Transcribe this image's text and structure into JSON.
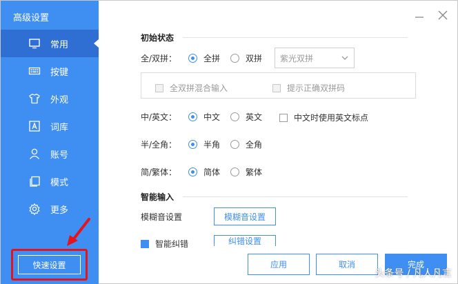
{
  "sidebar": {
    "title": "高级设置",
    "items": [
      {
        "label": "常用",
        "icon": "monitor-icon",
        "active": true
      },
      {
        "label": "按键",
        "icon": "keyboard-icon",
        "active": false
      },
      {
        "label": "外观",
        "icon": "shirt-icon",
        "active": false
      },
      {
        "label": "词库",
        "icon": "dictionary-icon",
        "active": false
      },
      {
        "label": "账号",
        "icon": "user-icon",
        "active": false
      },
      {
        "label": "模式",
        "icon": "copy-icon",
        "active": false
      },
      {
        "label": "更多",
        "icon": "gear-icon",
        "active": false
      }
    ],
    "quick_setup_label": "快速设置"
  },
  "window_controls": {
    "minimize_icon": "minimize-icon",
    "close_icon": "close-icon"
  },
  "initial_state": {
    "title": "初始状态",
    "full_double": {
      "label": "全/双拼：",
      "options": [
        "全拼",
        "双拼"
      ],
      "selected": "全拼"
    },
    "scheme_select": {
      "value": "紫光双拼"
    },
    "mixed_input_label": "全双拼混合输入",
    "hint_label": "提示正确双拼码",
    "cn_en": {
      "label": "中/英文：",
      "options": [
        "中文",
        "英文"
      ],
      "selected": "中文"
    },
    "punct_check_label": "中文时使用英文标点",
    "half_full": {
      "label": "半/全角：",
      "options": [
        "半角",
        "全角"
      ],
      "selected": "半角"
    },
    "simp_trad": {
      "label": "简/繁体：",
      "options": [
        "简体",
        "繁体"
      ],
      "selected": "简体"
    }
  },
  "smart_input": {
    "title": "智能输入",
    "fuzzy_label": "模糊音设置",
    "fuzzy_button": "模糊音设置",
    "partial_check_label": "智能纠错",
    "partial_button": "纠错设置"
  },
  "footer": {
    "apply": "应用",
    "cancel": "取消",
    "done": "完成"
  },
  "watermark": "头条号 / 凡人凡言",
  "colors": {
    "accent": "#3f8ef2",
    "sidebar_active": "#2f6fd4",
    "highlight_red": "#e3141c"
  }
}
